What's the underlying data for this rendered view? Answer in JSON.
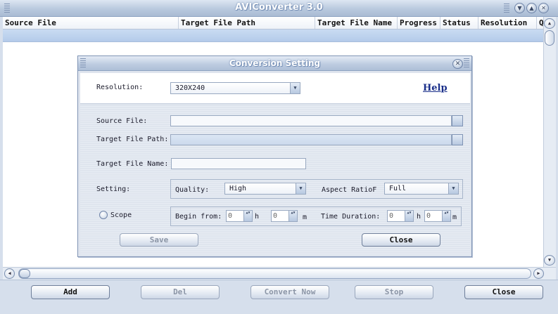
{
  "window": {
    "title": "AVIConverter 3.0",
    "minimize_glyph": "▼",
    "maximize_glyph": "▲",
    "close_glyph": "✕"
  },
  "table": {
    "columns": [
      "Source File",
      "Target File Path",
      "Target File Name",
      "Progress",
      "Status",
      "Resolution",
      "Q"
    ]
  },
  "scrollbars": {
    "up_glyph": "▲",
    "down_glyph": "▼",
    "left_glyph": "◀",
    "right_glyph": "▶"
  },
  "toolbar": {
    "add": "Add",
    "del": "Del",
    "convert_now": "Convert Now",
    "stop": "Stop",
    "close": "Close"
  },
  "dialog": {
    "title": "Conversion Setting",
    "close_glyph": "✕",
    "resolution_label": "Resolution:",
    "resolution_value": "320X240",
    "help": "Help",
    "source_file_label": "Source File:",
    "source_file_value": "",
    "target_path_label": "Target File Path:",
    "target_path_value": "",
    "target_name_label": "Target File Name:",
    "target_name_value": "",
    "setting_label": "Setting:",
    "quality_label": "Quality:",
    "quality_value": "High",
    "aspect_label": "Aspect RatioF",
    "aspect_value": "Full",
    "scope_label": "Scope",
    "begin_label": "Begin from:",
    "begin_h_value": "0",
    "h_unit": "h",
    "begin_m_value": "0",
    "m_unit": "m",
    "duration_label": "Time Duration:",
    "duration_h_value": "0",
    "duration_m_value": "0",
    "save": "Save",
    "close": "Close",
    "combo_arrow_glyph": "▼",
    "spin_glyph": "▲▼"
  }
}
